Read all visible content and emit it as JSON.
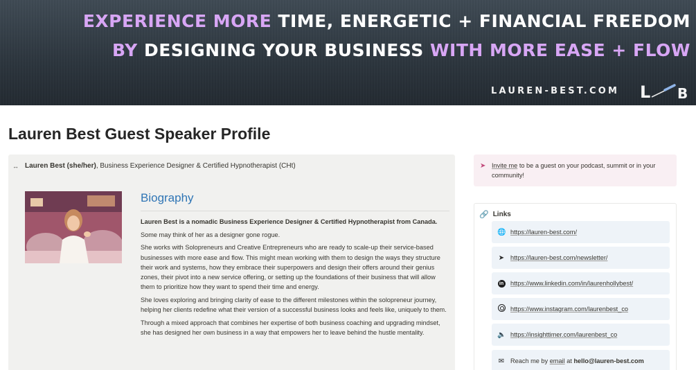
{
  "banner": {
    "line1_highlight": "EXPERIENCE MORE",
    "line1_rest": " TIME, ENERGETIC + FINANCIAL FREEDOM",
    "line2_start": "BY",
    "line2_mid": " DESIGNING YOUR BUSINESS ",
    "line2_highlight": "WITH MORE EASE + FLOW",
    "site": "LAUREN-BEST.COM",
    "logo_text": "L B",
    "accent_color": "#d8a6f5"
  },
  "page": {
    "title": "Lauren Best Guest Speaker Profile"
  },
  "author": {
    "icon": "link-glyph-icon",
    "name": "Lauren Best (she/her)",
    "role": ", Business Experience Designer & Certified Hypnotherapist (CHt)"
  },
  "biography": {
    "heading": "Biography",
    "heading_color": "#2f75b5",
    "paragraphs": [
      "Lauren Best is a nomadic Business Experience Designer & Certified Hypnotherapist from Canada.",
      "Some may think of her as a designer gone rogue.",
      "She works with Solopreneurs and Creative Entrepreneurs who are ready to scale-up their service-based businesses with more ease and flow. This might mean working with them to design the ways they structure their work and systems, how they embrace their superpowers and design their offers around their genius zones, their pivot into a new service offering, or setting up the foundations of their business that will allow them to prioritize how they want to spend their time and energy.",
      "She loves exploring and bringing clarity of ease to the different milestones within the solopreneur journey, helping her clients redefine what their version of a successful business looks and feels like, uniquely to them.",
      "Through a mixed approach that combines her expertise of both business coaching and upgrading mindset, she has designed her own business in a way that empowers her to leave behind the hustle mentality."
    ]
  },
  "invite": {
    "icon": "paper-plane-icon",
    "link_text": "Invite me",
    "rest_text": " to be a guest on your podcast, summit or in your community!",
    "accent_color": "#c24a7b"
  },
  "links": {
    "title": "Links",
    "icon": "chain-link-icon",
    "items": [
      {
        "icon": "globe-icon",
        "text": "https://lauren-best.com/"
      },
      {
        "icon": "paper-plane-icon",
        "text": "https://lauren-best.com/newsletter/"
      },
      {
        "icon": "linkedin-icon",
        "text": "https://www.linkedin.com/in/laurenhollybest/"
      },
      {
        "icon": "instagram-icon",
        "text": "https://www.instagram.com/laurenbest_co"
      },
      {
        "icon": "speaker-icon",
        "text": "https://insighttimer.com/laurenbest_co"
      }
    ],
    "email": {
      "icon": "envelope-icon",
      "prefix": "Reach me by ",
      "link_text": "email",
      "mid": " at ",
      "address": "hello@lauren-best.com"
    }
  }
}
